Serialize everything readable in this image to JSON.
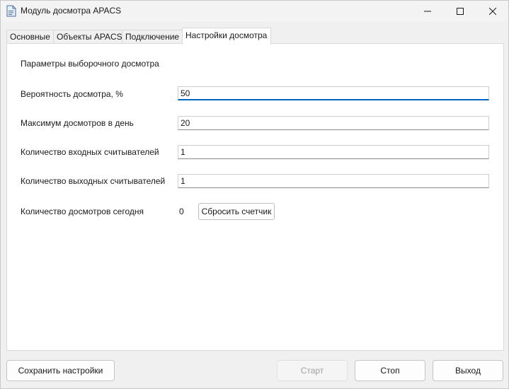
{
  "window": {
    "title": "Модуль досмотра APACS"
  },
  "tabs": [
    {
      "label": "Основные",
      "active": false
    },
    {
      "label": "Объекты APACS",
      "active": false
    },
    {
      "label": "Подключение",
      "active": false
    },
    {
      "label": "Настройки досмотра",
      "active": true
    }
  ],
  "panel": {
    "section_title": "Параметры выборочного досмотра",
    "rows": [
      {
        "label": "Вероятность досмотра, %",
        "value": "50"
      },
      {
        "label": "Максимум досмотров в день",
        "value": "20"
      },
      {
        "label": "Количество входных считывателей",
        "value": "1"
      },
      {
        "label": "Количество выходных считывателей",
        "value": "1"
      }
    ],
    "today": {
      "label": "Количество досмотров сегодня",
      "value": "0",
      "reset_label": "Сбросить счетчик"
    }
  },
  "buttons": {
    "save": "Сохранить настройки",
    "start": "Старт",
    "stop": "Стоп",
    "exit": "Выход"
  },
  "colors": {
    "accent": "#0067c0",
    "window_bg": "#f0f0f0",
    "panel_bg": "#ffffff"
  }
}
